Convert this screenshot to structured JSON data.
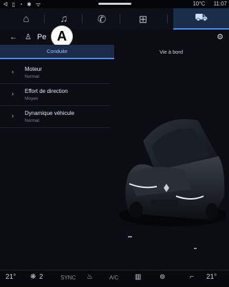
{
  "status": {
    "left_icons": "ᐊ ▯ ◔ ✱ ᯤ",
    "temperature": "10°C",
    "time": "11:07"
  },
  "nav": {
    "tabs": [
      {
        "name": "home-icon",
        "glyph": "⌂"
      },
      {
        "name": "music-icon",
        "glyph": "♫"
      },
      {
        "name": "phone-icon",
        "glyph": "✆"
      },
      {
        "name": "apps-icon",
        "glyph": "⊞"
      },
      {
        "name": "car-icon",
        "glyph": "⛟"
      }
    ],
    "active_index": 4
  },
  "header": {
    "title": "Pe",
    "marker": "A"
  },
  "subtabs": {
    "left": "Conduite",
    "right": "Vie à bord"
  },
  "items": [
    {
      "label": "Moteur",
      "value": "Normal"
    },
    {
      "label": "Effort de direction",
      "value": "Moyen"
    },
    {
      "label": "Dynamique véhicule",
      "value": "Normal"
    }
  ],
  "climate": {
    "left_temp": "21°",
    "left_seats": "2",
    "sync": "SYNC",
    "ac": "A/C",
    "right_temp": "21°"
  },
  "colors": {
    "accent": "#4e8cff",
    "active_bg": "#1a2c49",
    "background": "#0b0d12"
  }
}
